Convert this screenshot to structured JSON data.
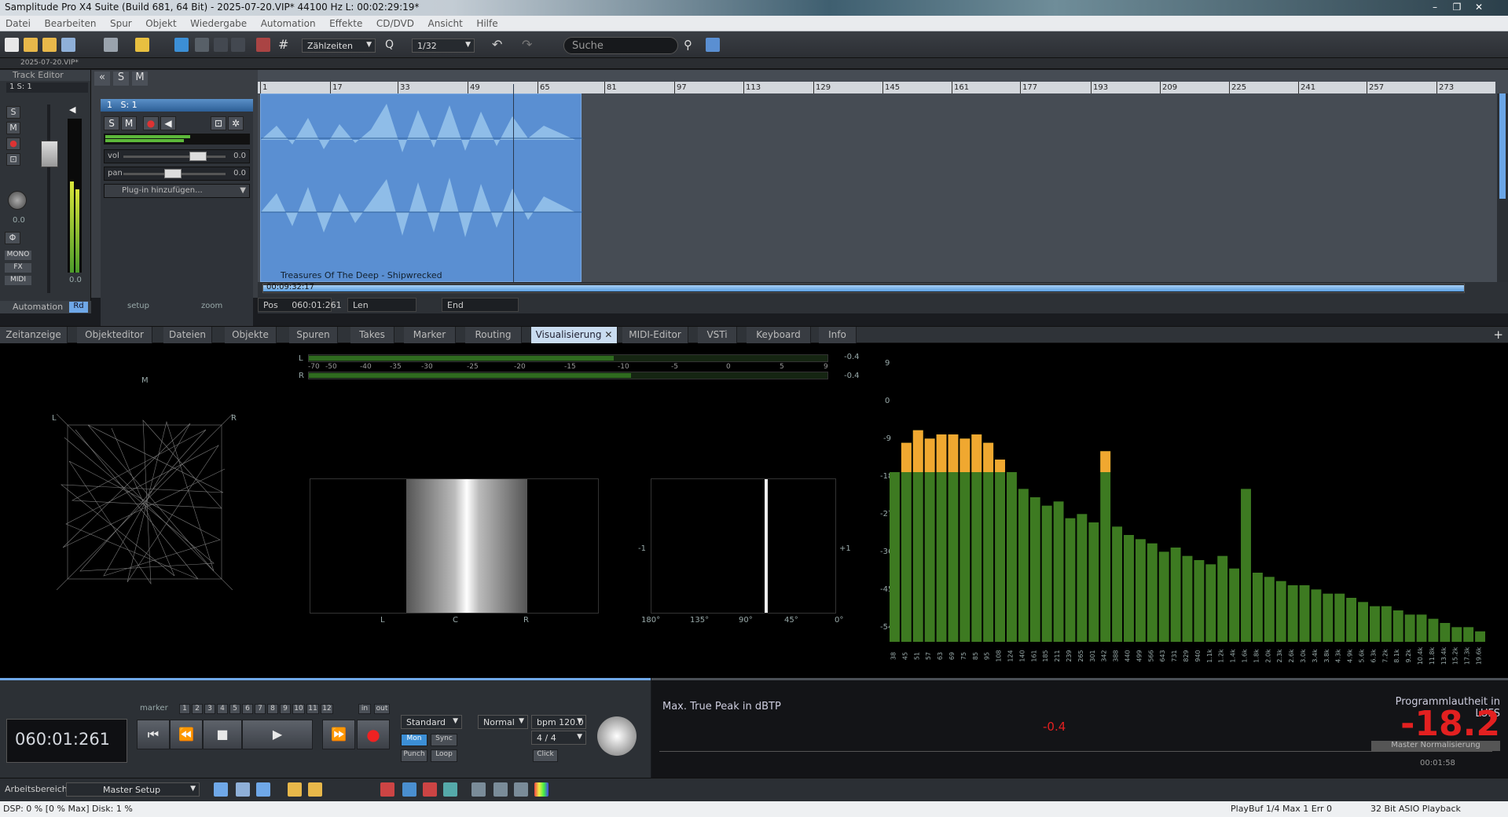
{
  "title": "Samplitude Pro X4 Suite (Build 681, 64 Bit) -  2025-07-20.VIP*   44100 Hz L: 00:02:29:19*",
  "menu": [
    "Datei",
    "Bearbeiten",
    "Spur",
    "Objekt",
    "Wiedergabe",
    "Automation",
    "Effekte",
    "CD/DVD",
    "Ansicht",
    "Hilfe"
  ],
  "toolbar": {
    "timeline_mode": "Zählzeiten",
    "quantize": "1/32",
    "search_placeholder": "Suche"
  },
  "project_tab": "2025-07-20.VIP*",
  "track_editor": {
    "title": "Track Editor",
    "track": "1   S: 1",
    "btn_s": "S",
    "btn_m": "M",
    "mono": "MONO",
    "fx": "FX",
    "midi": "MIDI",
    "pan_value": "0.0",
    "meter_value": "0.0",
    "automation": "Automation",
    "rd": "Rd"
  },
  "track": {
    "number": "1",
    "name": "S: 1",
    "vol_label": "vol",
    "vol_value": "0.0",
    "pan_label": "pan",
    "pan_value": "0.0",
    "plugin": "Plug-in hinzufügen...",
    "clip_name": "Treasures Of The Deep - Shipwrecked",
    "setup": "setup",
    "zoom": "zoom"
  },
  "ruler": [
    "1",
    "17",
    "33",
    "49",
    "65",
    "81",
    "97",
    "113",
    "129",
    "145",
    "161",
    "177",
    "193",
    "209",
    "225",
    "241",
    "257",
    "273"
  ],
  "position": {
    "time": "00:09:32:17",
    "pos_label": "Pos",
    "pos_value": "060:01:261",
    "len_label": "Len",
    "end_label": "End"
  },
  "tabs": [
    "Zeitanzeige",
    "Objekteditor",
    "Dateien",
    "Objekte",
    "Spuren",
    "Takes",
    "Marker",
    "Routing",
    "Visualisierung",
    "MIDI-Editor",
    "VSTi",
    "Keyboard",
    "Info"
  ],
  "active_tab": "Visualisierung",
  "vis": {
    "goniometer": {
      "m": "M",
      "l": "L",
      "r": "R"
    },
    "meter_scale": [
      "-70",
      "-50",
      "-40",
      "-35",
      "-30",
      "-25",
      "-20",
      "-15",
      "-10",
      "-5",
      "0",
      "5",
      "9"
    ],
    "meter_l": "L",
    "meter_r": "R",
    "meter_l_peak": "-0.4",
    "meter_r_peak": "-0.4",
    "stereo_labels": [
      "L",
      "C",
      "R"
    ],
    "phase_labels": [
      "180°",
      "135°",
      "90°",
      "45°",
      "0°"
    ],
    "phase_minus": "-1",
    "phase_plus": "+1",
    "spectrum_y": [
      "9",
      "0",
      "-9",
      "-18",
      "-27",
      "-36",
      "-45",
      "-54"
    ],
    "spectrum_x": [
      "38",
      "45",
      "51",
      "57",
      "63",
      "69",
      "75",
      "85",
      "95",
      "108",
      "124",
      "140",
      "161",
      "185",
      "211",
      "239",
      "265",
      "301",
      "342",
      "388",
      "440",
      "499",
      "566",
      "643",
      "731",
      "829",
      "940",
      "1.1k",
      "1.2k",
      "1.4k",
      "1.6k",
      "1.8k",
      "2.0k",
      "2.3k",
      "2.6k",
      "3.0k",
      "3.4k",
      "3.8k",
      "4.3k",
      "4.9k",
      "5.6k",
      "6.3k",
      "7.2k",
      "8.1k",
      "9.2k",
      "10.4k",
      "11.8k",
      "13.4k",
      "15.2k",
      "17.3k",
      "19.6k"
    ]
  },
  "transport": {
    "time": "060:01:261",
    "marker": "marker",
    "numbers": [
      "1",
      "2",
      "3",
      "4",
      "5",
      "6",
      "7",
      "8",
      "9",
      "10",
      "11",
      "12"
    ],
    "in": "in",
    "out": "out",
    "preset": "Standard",
    "mon": "Mon",
    "sync": "Sync",
    "punch": "Punch",
    "loop": "Loop",
    "mode": "Normal",
    "bpm": "bpm 120.0",
    "sig": "4 / 4",
    "click": "Click"
  },
  "lufs": {
    "true_peak_label": "Max. True Peak in dBTP",
    "true_peak_value": "-0.4",
    "loudness_label": "Programmlautheit in LUFS",
    "loudness_value": "-18.2",
    "normalize": "Master Normalisierung",
    "elapsed": "00:01:58"
  },
  "workspace": {
    "label": "Arbeitsbereich:",
    "value": "Master Setup"
  },
  "status": {
    "dsp": "DSP: 0 %   [0 % Max]    Disk:  1 %",
    "playbuf": "PlayBuf 1/4  Max 1  Err 0",
    "asio": "32 Bit ASIO Playback"
  },
  "colors": {
    "accent": "#6fa8e8",
    "clip": "#5a8fd2",
    "spectrum_green": "#3d7a21",
    "spectrum_peak": "#f0a830",
    "lufs_red": "#e32020"
  }
}
